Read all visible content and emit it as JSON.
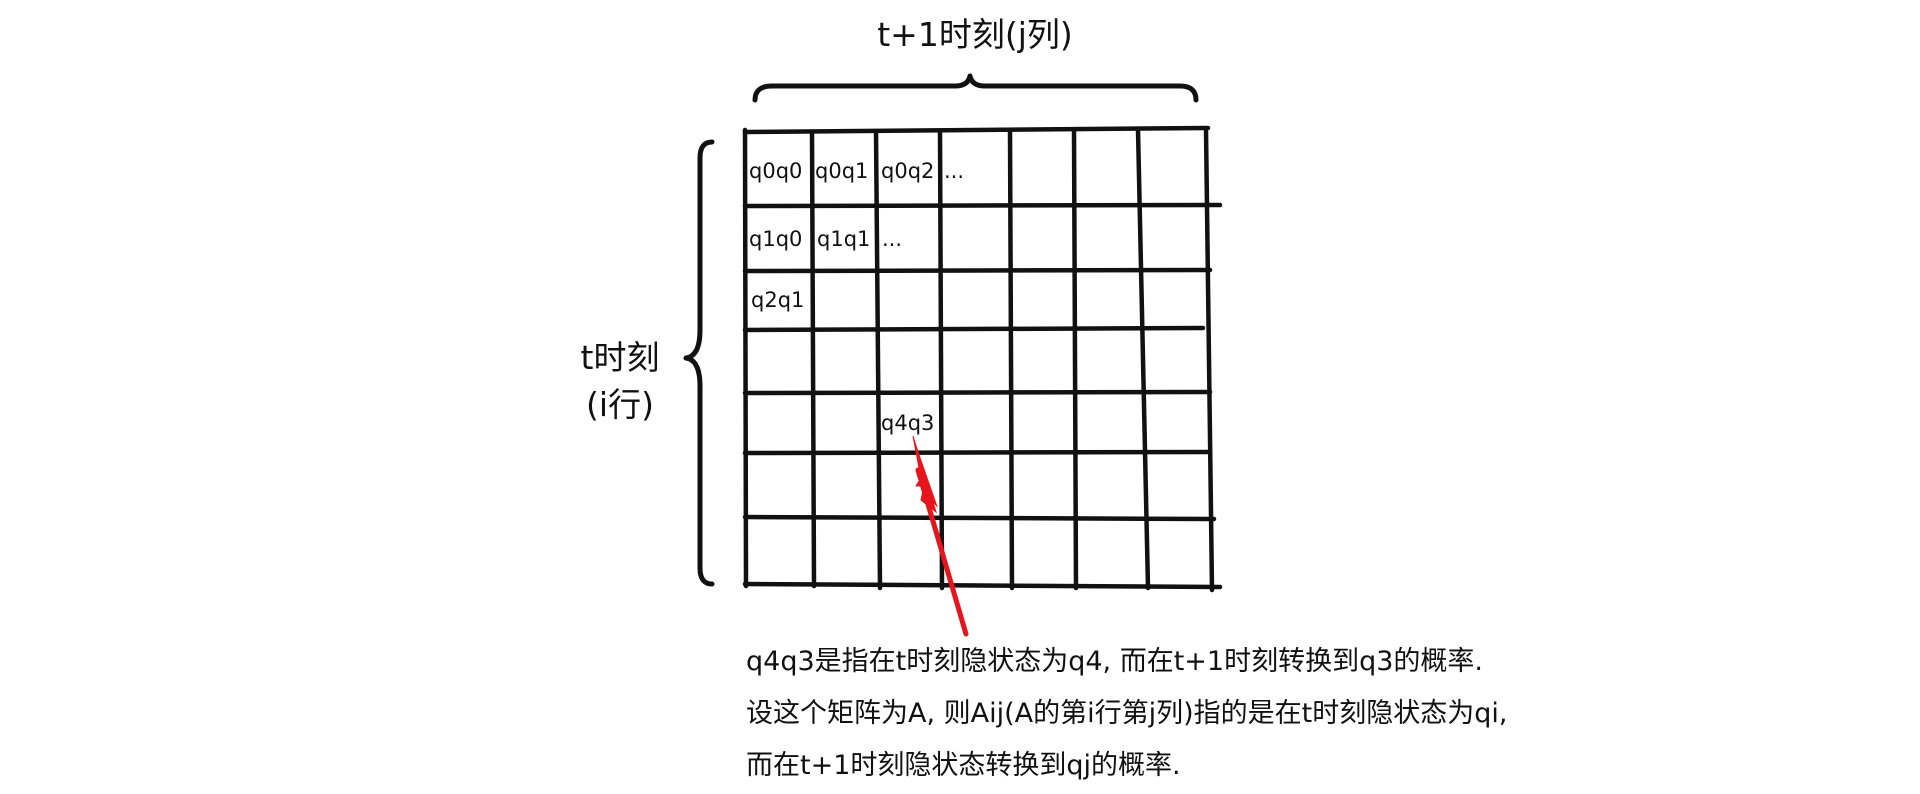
{
  "top_label": "t+1时刻(j列)",
  "side_label": {
    "line1": "t时刻",
    "line2": "(i行)"
  },
  "cells": {
    "r0c0": "q0q0",
    "r0c1": "q0q1",
    "r0c2": "q0q2",
    "r0c3": "...",
    "r1c0": "q1q0",
    "r1c1": "q1q1",
    "r1c2": "...",
    "r2c0": "q2q1",
    "r4c2": "q4q3"
  },
  "caption": {
    "line1": "q4q3是指在t时刻隐状态为q4, 而在t+1时刻转换到q3的概率.",
    "line2": "设这个矩阵为A, 则Aij(A的第i行第j列)指的是在t时刻隐状态为qi,",
    "line3": "而在t+1时刻隐状态转换到qj的概率."
  },
  "colors": {
    "grid": "#111111",
    "arrow": "#e8141c",
    "text": "#111111"
  }
}
